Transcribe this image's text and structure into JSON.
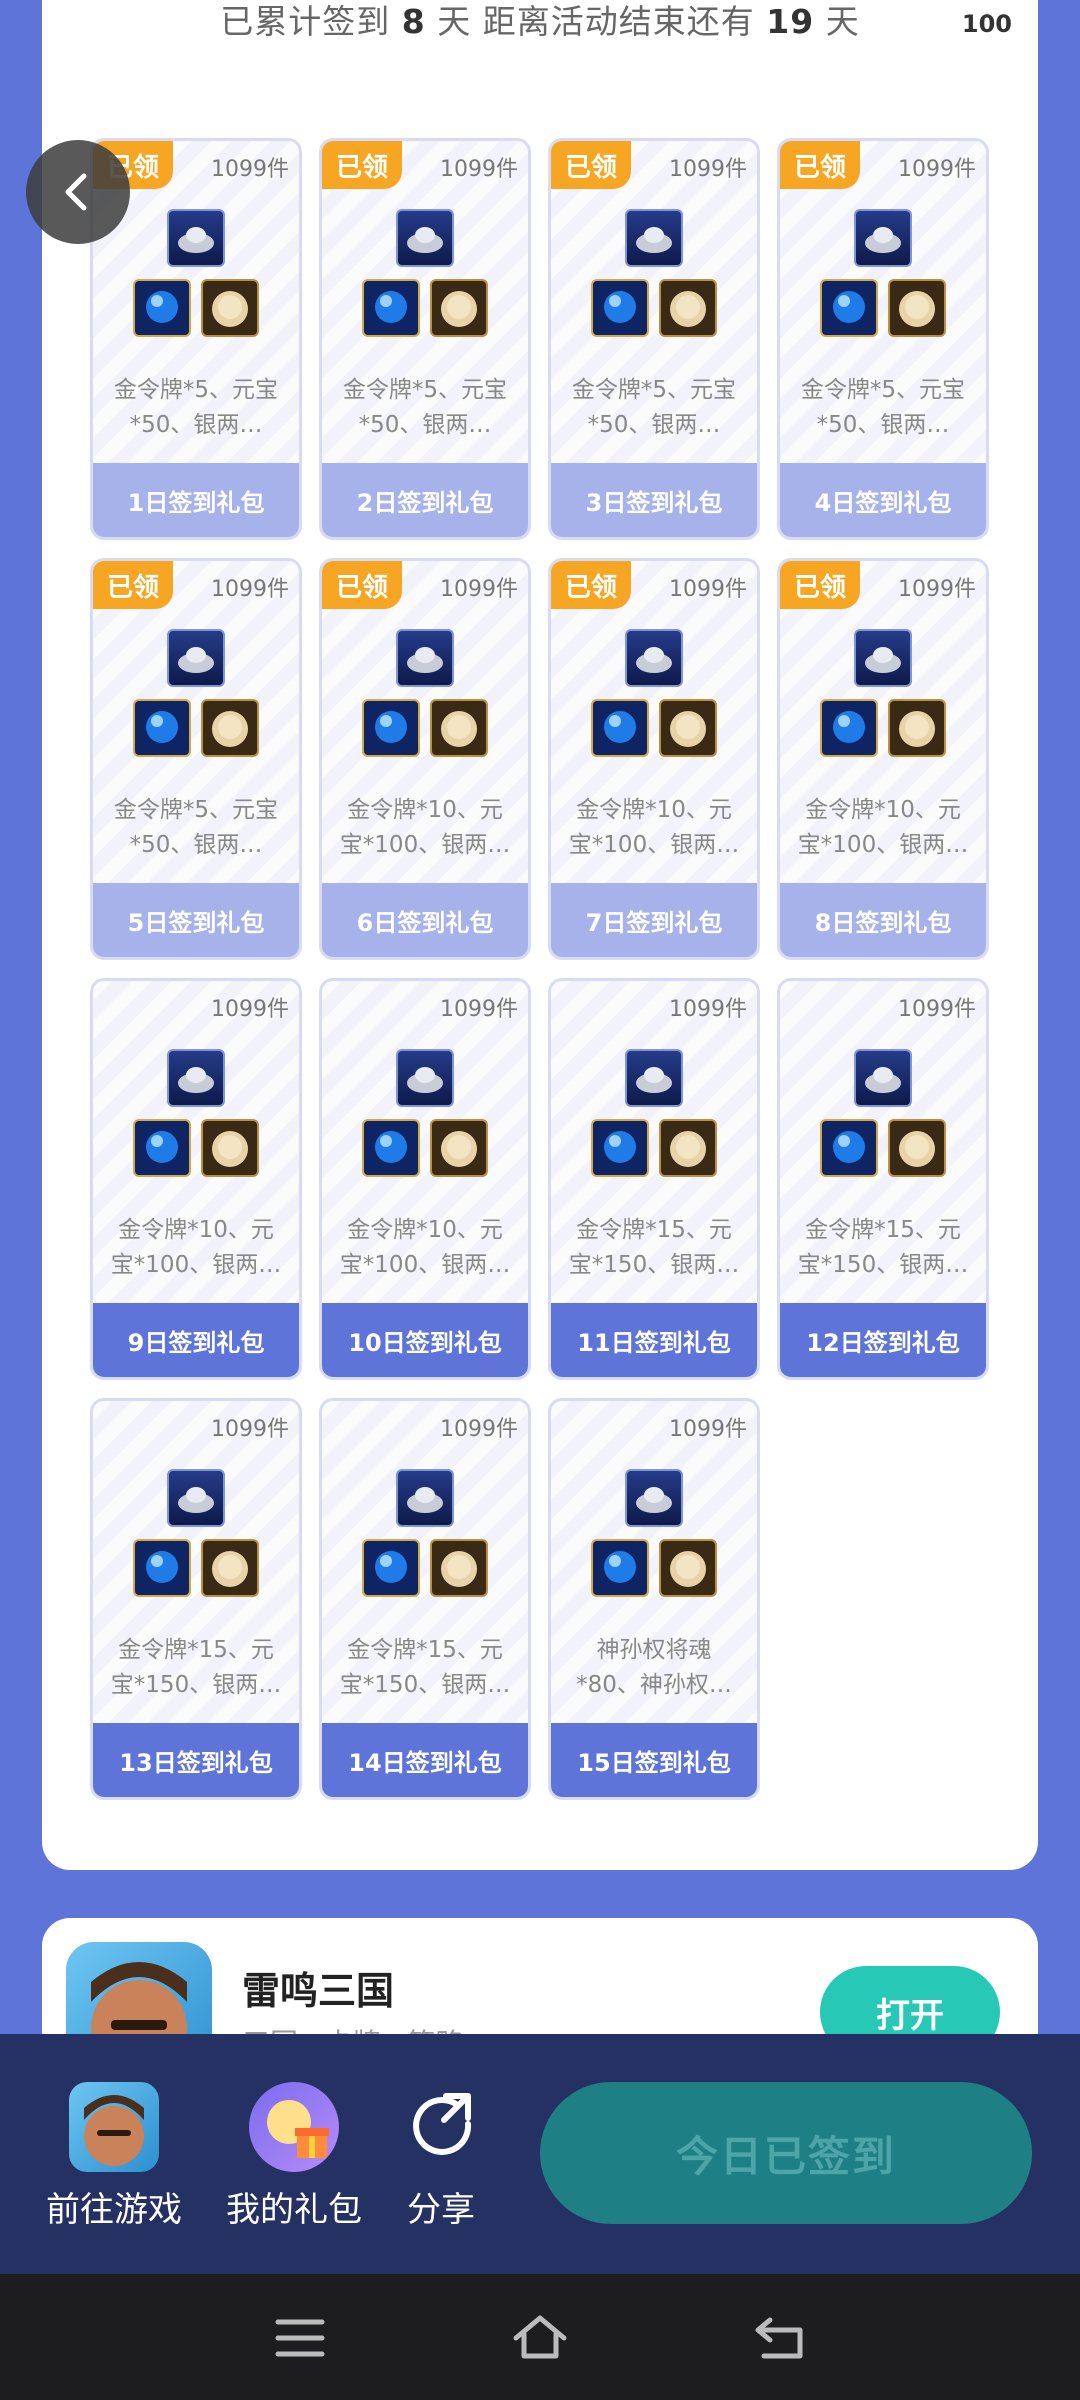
{
  "header": {
    "summary_prefix": "已累计签到",
    "days_signed": "8",
    "summary_mid": "天  距离活动结束还有",
    "days_left": "19",
    "summary_suffix": "天",
    "corner_count": "100"
  },
  "tiles": [
    {
      "tag": "已领",
      "qty": "1099件",
      "desc": "金令牌*5、元宝*50、银两…",
      "label": "1日签到礼包",
      "claimed": true
    },
    {
      "tag": "已领",
      "qty": "1099件",
      "desc": "金令牌*5、元宝*50、银两…",
      "label": "2日签到礼包",
      "claimed": true
    },
    {
      "tag": "已领",
      "qty": "1099件",
      "desc": "金令牌*5、元宝*50、银两…",
      "label": "3日签到礼包",
      "claimed": true
    },
    {
      "tag": "已领",
      "qty": "1099件",
      "desc": "金令牌*5、元宝*50、银两…",
      "label": "4日签到礼包",
      "claimed": true
    },
    {
      "tag": "已领",
      "qty": "1099件",
      "desc": "金令牌*5、元宝*50、银两…",
      "label": "5日签到礼包",
      "claimed": true
    },
    {
      "tag": "已领",
      "qty": "1099件",
      "desc": "金令牌*10、元宝*100、银两…",
      "label": "6日签到礼包",
      "claimed": true
    },
    {
      "tag": "已领",
      "qty": "1099件",
      "desc": "金令牌*10、元宝*100、银两…",
      "label": "7日签到礼包",
      "claimed": true
    },
    {
      "tag": "已领",
      "qty": "1099件",
      "desc": "金令牌*10、元宝*100、银两…",
      "label": "8日签到礼包",
      "claimed": true
    },
    {
      "tag": "",
      "qty": "1099件",
      "desc": "金令牌*10、元宝*100、银两…",
      "label": "9日签到礼包",
      "claimed": false
    },
    {
      "tag": "",
      "qty": "1099件",
      "desc": "金令牌*10、元宝*100、银两…",
      "label": "10日签到礼包",
      "claimed": false
    },
    {
      "tag": "",
      "qty": "1099件",
      "desc": "金令牌*15、元宝*150、银两…",
      "label": "11日签到礼包",
      "claimed": false
    },
    {
      "tag": "",
      "qty": "1099件",
      "desc": "金令牌*15、元宝*150、银两…",
      "label": "12日签到礼包",
      "claimed": false
    },
    {
      "tag": "",
      "qty": "1099件",
      "desc": "金令牌*15、元宝*150、银两…",
      "label": "13日签到礼包",
      "claimed": false
    },
    {
      "tag": "",
      "qty": "1099件",
      "desc": "金令牌*15、元宝*150、银两…",
      "label": "14日签到礼包",
      "claimed": false
    },
    {
      "tag": "",
      "qty": "1099件",
      "desc": "神孙权将魂*80、神孙权…",
      "label": "15日签到礼包",
      "claimed": false
    }
  ],
  "game": {
    "name": "雷鸣三国",
    "meta": "三国 · 卡牌 · 策略",
    "open_label": "打开"
  },
  "bottom": {
    "go_game": "前往游戏",
    "my_gifts": "我的礼包",
    "share": "分享",
    "checkin": "今日已签到"
  },
  "colors": {
    "background": "#5f74d8",
    "claimed_tag": "#f7a623",
    "open_button": "#27c8b6",
    "bottom_bar": "#263163"
  }
}
